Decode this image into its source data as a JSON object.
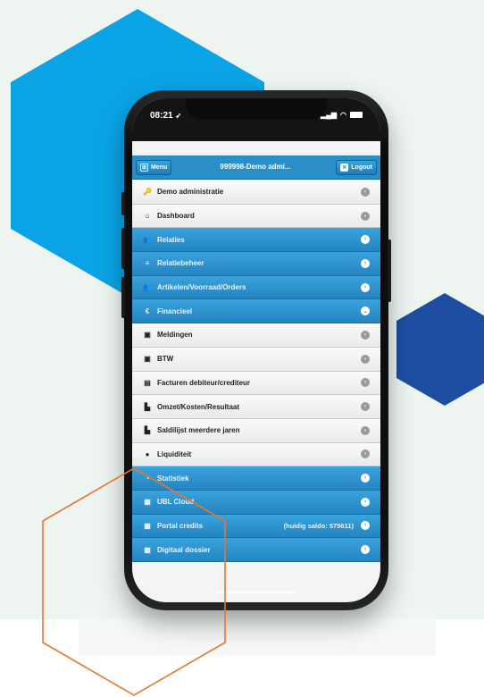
{
  "status_bar": {
    "time": "08:21",
    "location_glyph": "➶"
  },
  "header": {
    "menu_label": "Menu",
    "title": "999998-Demo admi...",
    "logout_label": "Logout"
  },
  "menu": {
    "items": [
      {
        "label": "Demo administratie",
        "style": "light",
        "icon": "key-icon",
        "glyph": "🔑",
        "arrow": "›"
      },
      {
        "label": "Dashboard",
        "style": "light",
        "icon": "home-icon",
        "glyph": "⌂",
        "arrow": "›"
      },
      {
        "label": "Relaties",
        "style": "blue",
        "icon": "people-icon",
        "glyph": "👥",
        "arrow": "›"
      },
      {
        "label": "Relatiebeheer",
        "style": "blue",
        "icon": "list-icon",
        "glyph": "≡",
        "arrow": "›"
      },
      {
        "label": "Artikelen/Voorraad/Orders",
        "style": "blue",
        "icon": "people-icon",
        "glyph": "👥",
        "arrow": "›"
      },
      {
        "label": "Financieel",
        "style": "blue",
        "icon": "finance-icon",
        "glyph": "€",
        "arrow": "⌄"
      },
      {
        "label": "Meldingen",
        "style": "light",
        "icon": "notification-icon",
        "glyph": "▣",
        "arrow": "›"
      },
      {
        "label": "BTW",
        "style": "light",
        "icon": "tax-icon",
        "glyph": "▣",
        "arrow": "›"
      },
      {
        "label": "Facturen debiteur/crediteur",
        "style": "light",
        "icon": "document-icon",
        "glyph": "▤",
        "arrow": "›"
      },
      {
        "label": "Omzet/Kosten/Resultaat",
        "style": "light",
        "icon": "bar-chart-icon",
        "glyph": "▙",
        "arrow": "›"
      },
      {
        "label": "Saldilijst meerdere jaren",
        "style": "light",
        "icon": "bar-chart-icon",
        "glyph": "▙",
        "arrow": "›"
      },
      {
        "label": "Liquiditeit",
        "style": "light",
        "icon": "cash-icon",
        "glyph": "●",
        "arrow": "›"
      },
      {
        "label": "Statistiek",
        "style": "blue",
        "icon": "stats-icon",
        "glyph": "◔",
        "arrow": "›"
      },
      {
        "label": "UBL Cloud",
        "style": "blue",
        "icon": "cloud-icon",
        "glyph": "▦",
        "arrow": "›"
      },
      {
        "label": "Portal credits",
        "style": "blue",
        "icon": "credits-icon",
        "glyph": "▦",
        "arrow": "›",
        "extra": "(huidig saldo: 575611)"
      },
      {
        "label": "Digitaal dossier",
        "style": "blue",
        "icon": "folder-icon",
        "glyph": "▦",
        "arrow": "›"
      }
    ]
  },
  "colors": {
    "brand_blue": "#2a8fc8",
    "hexagon_light_blue": "#0aa4e6",
    "hexagon_dark_blue": "#1d4ea1",
    "hexagon_orange_outline": "#e87530",
    "background": "#eef5f1"
  }
}
